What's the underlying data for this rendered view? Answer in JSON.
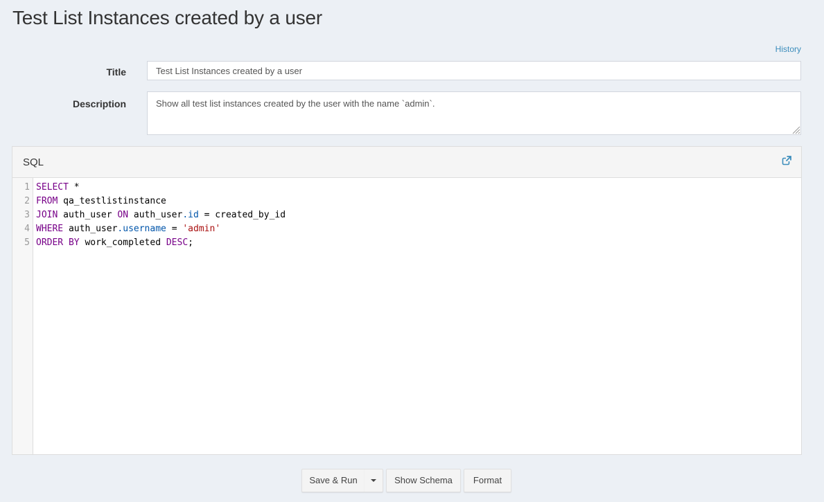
{
  "page": {
    "title": "Test List Instances created by a user"
  },
  "history_link": "History",
  "form": {
    "title_label": "Title",
    "title_value": "Test List Instances created by a user",
    "description_label": "Description",
    "description_value": "Show all test list instances created by the user with the name `admin`."
  },
  "sql_panel": {
    "header": "SQL",
    "line_numbers": [
      "1",
      "2",
      "3",
      "4",
      "5"
    ],
    "lines": [
      [
        {
          "t": "SELECT",
          "c": "kw"
        },
        {
          "t": " *",
          "c": ""
        }
      ],
      [
        {
          "t": "FROM",
          "c": "kw"
        },
        {
          "t": " qa_testlistinstance",
          "c": ""
        }
      ],
      [
        {
          "t": "JOIN",
          "c": "kw"
        },
        {
          "t": " auth_user ",
          "c": ""
        },
        {
          "t": "ON",
          "c": "kw"
        },
        {
          "t": " auth_user",
          "c": ""
        },
        {
          "t": ".id",
          "c": "prop"
        },
        {
          "t": " = created_by_id",
          "c": ""
        }
      ],
      [
        {
          "t": "WHERE",
          "c": "kw"
        },
        {
          "t": " auth_user",
          "c": ""
        },
        {
          "t": ".username",
          "c": "prop"
        },
        {
          "t": " = ",
          "c": ""
        },
        {
          "t": "'admin'",
          "c": "str"
        }
      ],
      [
        {
          "t": "ORDER BY",
          "c": "kw"
        },
        {
          "t": " work_completed ",
          "c": ""
        },
        {
          "t": "DESC",
          "c": "kw"
        },
        {
          "t": ";",
          "c": ""
        }
      ]
    ]
  },
  "buttons": {
    "save_run": "Save & Run",
    "show_schema": "Show Schema",
    "format": "Format"
  },
  "colors": {
    "background": "#ecf0f5",
    "link": "#3c8dbc",
    "sql_keyword": "#770088",
    "sql_property": "#0055aa",
    "sql_string": "#aa1111"
  },
  "icons": {
    "popout": "external-link-icon",
    "dropdown": "caret-down-icon",
    "resize": "resize-grip-icon"
  }
}
